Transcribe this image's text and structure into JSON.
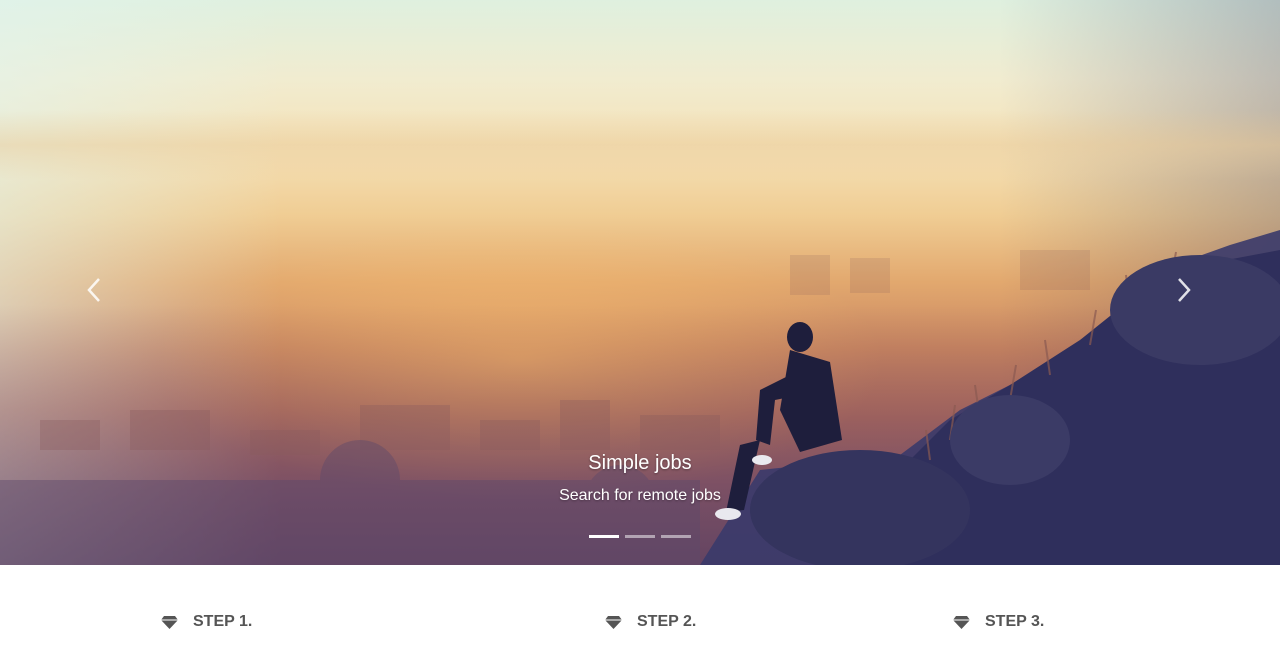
{
  "carousel": {
    "slide_title": "Simple jobs",
    "slide_subtitle": "Search for remote jobs",
    "prev_icon": "chevron-left-icon",
    "next_icon": "chevron-right-icon",
    "indicators": [
      {
        "active": true
      },
      {
        "active": false
      },
      {
        "active": false
      }
    ]
  },
  "steps": [
    {
      "label": "STEP 1.",
      "icon": "diamond-icon"
    },
    {
      "label": "STEP 2.",
      "icon": "diamond-icon"
    },
    {
      "label": "STEP 3.",
      "icon": "diamond-icon"
    }
  ],
  "colors": {
    "step_text": "#555555",
    "caption_text": "#ffffff"
  }
}
